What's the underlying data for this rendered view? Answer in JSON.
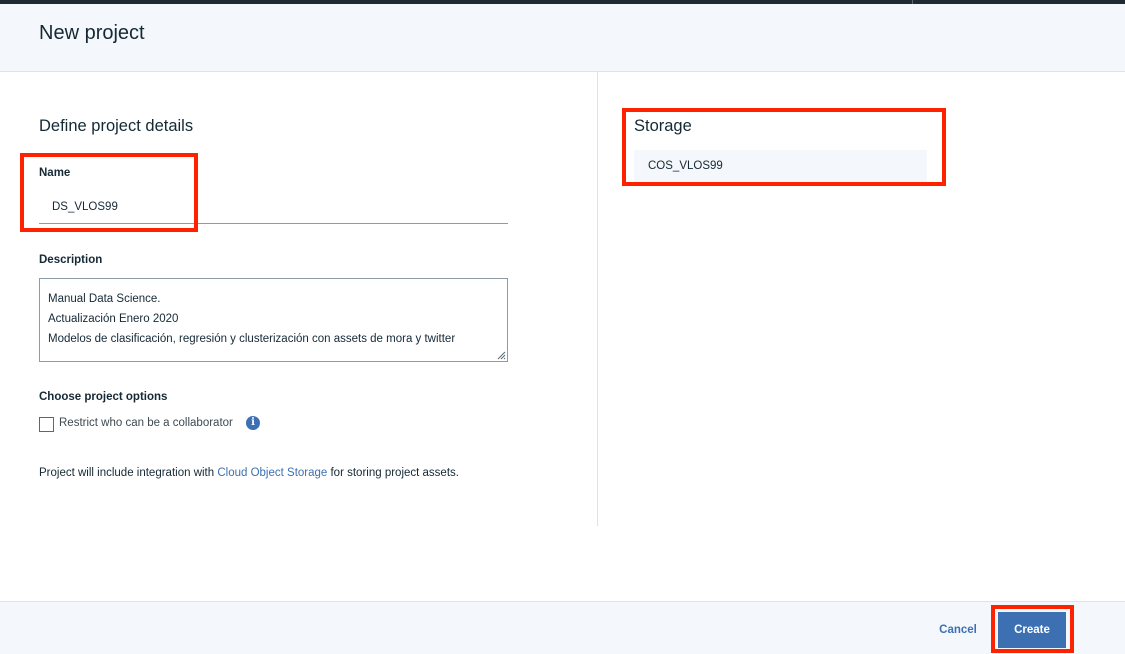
{
  "header": {
    "title": "New project"
  },
  "details": {
    "section_title": "Define project details",
    "name_label": "Name",
    "name_value": "DS_VLOS99",
    "description_label": "Description",
    "description_lines": [
      "Manual Data Science.",
      "Actualización Enero 2020",
      "Modelos de clasificación, regresión y clusterización con assets de mora y twitter"
    ],
    "options_label": "Choose project options",
    "restrict_label": "Restrict who can be a collaborator",
    "restrict_checked": false,
    "integration_prefix": "Project will include integration with ",
    "integration_link": "Cloud Object Storage",
    "integration_suffix": " for storing project assets."
  },
  "storage": {
    "title": "Storage",
    "value": "COS_VLOS99"
  },
  "footer": {
    "cancel_label": "Cancel",
    "create_label": "Create"
  },
  "icons": {
    "info": "info-icon"
  },
  "colors": {
    "accent": "#3d70b2",
    "highlight": "#ff2200",
    "header_bg": "#f4f7fb"
  }
}
